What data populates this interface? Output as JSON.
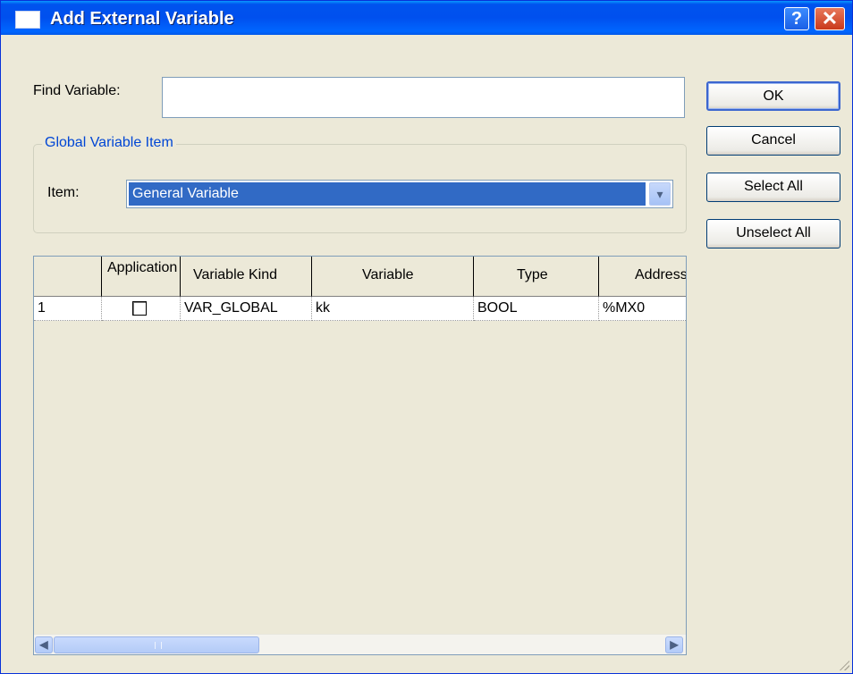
{
  "window": {
    "title": "Add External Variable",
    "help_label": "?",
    "close_label": "✕"
  },
  "find": {
    "label": "Find Variable:",
    "value": ""
  },
  "buttons": {
    "ok": "OK",
    "cancel": "Cancel",
    "select_all": "Select All",
    "unselect_all": "Unselect All"
  },
  "group": {
    "legend": "Global Variable Item",
    "item_label": "Item:",
    "item_value": "General Variable"
  },
  "grid": {
    "columns": [
      "",
      "Application",
      "Variable Kind",
      "Variable",
      "Type",
      "Address"
    ],
    "rows": [
      {
        "num": "1",
        "application_checked": false,
        "kind": "VAR_GLOBAL",
        "variable": "kk",
        "type": "BOOL",
        "address": "%MX0"
      }
    ]
  },
  "icons": {
    "scroll_left": "◀",
    "scroll_right": "▶",
    "dropdown": "▾"
  }
}
